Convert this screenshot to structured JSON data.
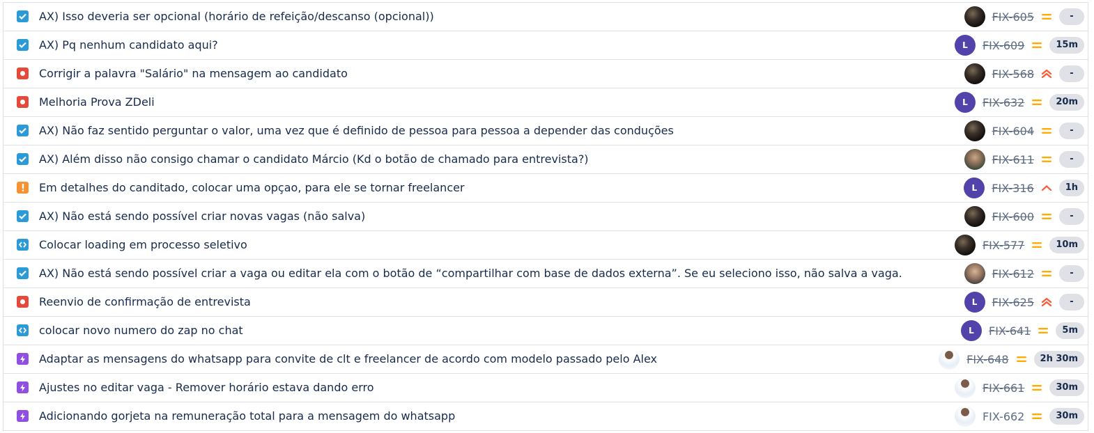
{
  "colors": {
    "task": "#2b9ad8",
    "bug": "#e5493a",
    "improvement": "#f79232",
    "subtask": "#904ee2",
    "priority_medium": "#ffab00",
    "priority_high": "#ff5630",
    "avatar_letter_bg": "#5243aa"
  },
  "issues": [
    {
      "type": "task-icon",
      "summary": "AX) Isso deveria ser opcional (horário de refeição/descanso (opcional))",
      "avatar": "photo",
      "key": "FIX-605",
      "priority": "medium",
      "estimate": "-"
    },
    {
      "type": "task-icon",
      "summary": "AX) Pq nenhum candidato aqui?",
      "avatar": "L",
      "key": "FIX-609",
      "priority": "medium",
      "estimate": "15m"
    },
    {
      "type": "bug-icon",
      "summary": "Corrigir a palavra \"Salário\" na mensagem ao candidato",
      "avatar": "photo",
      "key": "FIX-568",
      "priority": "highest",
      "estimate": "-"
    },
    {
      "type": "bug-icon",
      "summary": "Melhoria Prova ZDeli",
      "avatar": "L",
      "key": "FIX-632",
      "priority": "medium",
      "estimate": "20m"
    },
    {
      "type": "task-icon",
      "summary": "AX) Não faz sentido perguntar o valor, uma vez que é definido de pessoa para pessoa a depender das conduções",
      "avatar": "photo",
      "key": "FIX-604",
      "priority": "medium",
      "estimate": "-"
    },
    {
      "type": "task-icon",
      "summary": "AX) Além disso não consigo chamar o candidato Márcio (Kd o botão de chamado para entrevista?)",
      "avatar": "photo",
      "key": "FIX-611",
      "priority": "medium",
      "estimate": "-"
    },
    {
      "type": "improvement-icon",
      "summary": "Em detalhes do canditado, colocar uma opçao, para ele se tornar freelancer",
      "avatar": "L",
      "key": "FIX-316",
      "priority": "high",
      "estimate": "1h"
    },
    {
      "type": "task-icon",
      "summary": "AX) Não está sendo possível criar novas vagas (não salva)",
      "avatar": "photo",
      "key": "FIX-600",
      "priority": "medium",
      "estimate": "-"
    },
    {
      "type": "code-icon",
      "summary": "Colocar loading em processo seletivo",
      "avatar": "photo",
      "key": "FIX-577",
      "priority": "medium",
      "estimate": "10m"
    },
    {
      "type": "task-icon",
      "summary": "AX) Não está sendo possível criar a vaga ou editar ela com o botão de “compartilhar com base de dados externa”. Se eu seleciono isso, não salva a vaga.",
      "avatar": "photo",
      "key": "FIX-612",
      "priority": "medium",
      "estimate": "-"
    },
    {
      "type": "bug-icon",
      "summary": "Reenvio de confirmação de entrevista",
      "avatar": "L",
      "key": "FIX-625",
      "priority": "highest",
      "estimate": "-"
    },
    {
      "type": "code-icon",
      "summary": "colocar novo numero do zap no chat",
      "avatar": "L",
      "key": "FIX-641",
      "priority": "medium",
      "estimate": "5m"
    },
    {
      "type": "subtask-icon",
      "summary": "Adaptar as mensagens do whatsapp para convite de clt e freelancer de acordo com modelo passado pelo Alex",
      "avatar": "photo",
      "key": "FIX-648",
      "priority": "medium",
      "estimate": "2h 30m"
    },
    {
      "type": "subtask-icon",
      "summary": "Ajustes no editar vaga - Remover horário estava dando erro",
      "avatar": "photo",
      "key": "FIX-661",
      "priority": "medium",
      "estimate": "30m"
    },
    {
      "type": "subtask-icon",
      "summary": "Adicionando gorjeta na remuneração total para a mensagem do whatsapp",
      "avatar": "photo",
      "key": "FIX-662",
      "priority": "medium",
      "estimate": "30m"
    }
  ]
}
